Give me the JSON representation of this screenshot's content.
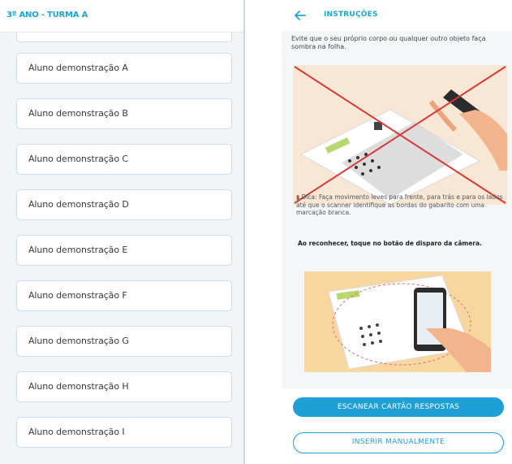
{
  "left_panel": {
    "title": "3º ANO - TURMA A",
    "students": [
      "Aluno demonstração A",
      "Aluno demonstração B",
      "Aluno demonstração C",
      "Aluno demonstração D",
      "Aluno demonstração E",
      "Aluno demonstração F",
      "Aluno demonstração G",
      "Aluno demonstração H",
      "Aluno demonstração I"
    ]
  },
  "right_panel": {
    "back_icon": "arrow-left-icon",
    "title": "INSTRUÇÕES",
    "intro_text": "Evite que o seu próprio corpo ou qualquer outro objeto faça sombra na folha.",
    "tip_text": "Dica: Faça movimento leves para frente, para trás e para os lados até que o scanner identifique as bordas do gabarito com uma marcação branca.",
    "tip_bold_text": "Ao reconhecer, toque no botão de disparo da câmera.",
    "scan_button": "ESCANEAR CARTÃO RESPOSTAS",
    "manual_button": "INSERIR MANUALMENTE"
  },
  "colors": {
    "accent": "#1e9fd6",
    "title_blue": "#1ca6d4",
    "card_border": "#c9dde8",
    "wrong_cross": "#d63b3b"
  }
}
